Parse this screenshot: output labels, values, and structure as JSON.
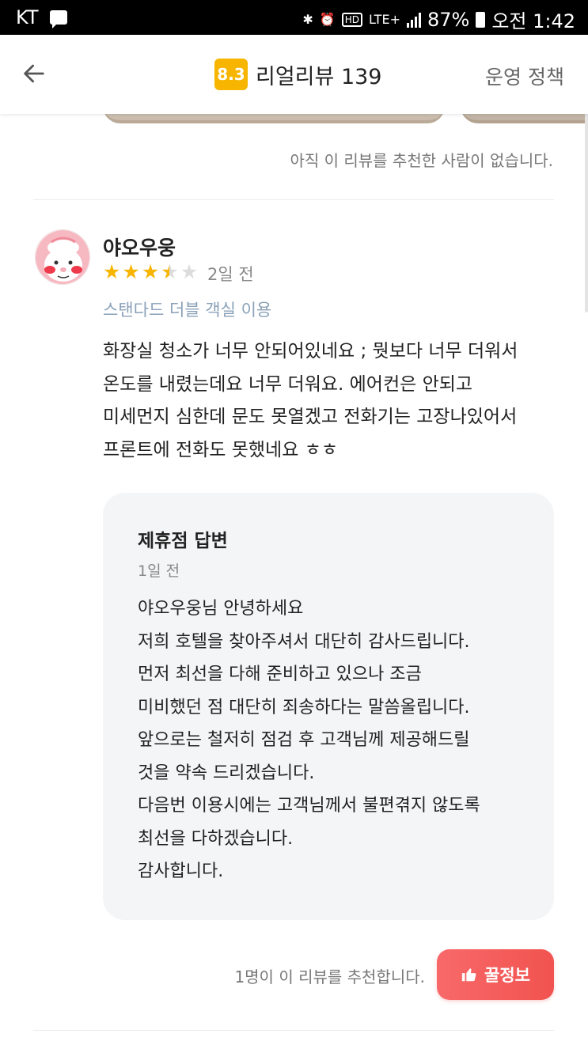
{
  "status_bar": {
    "carrier": "KT",
    "network": "LTE+",
    "hd": "HD",
    "battery": "87%",
    "time": "오전 1:42"
  },
  "header": {
    "score": "8.3",
    "title": "리얼리뷰 139",
    "policy_link": "운영 정책"
  },
  "previous_review": {
    "recommend_text": "아직 이 리뷰를 추천한 사람이 없습니다."
  },
  "review": {
    "reviewer": "야오우웅",
    "rating": 3.5,
    "date": "2일 전",
    "room_type": "스탠다드 더블 객실 이용",
    "body_lines": [
      "화장실 청소가 너무 안되어있네요 ; 뭣보다 너무 더워서",
      "온도를 내렸는데요 너무 더워요. 에어컨은 안되고",
      "미세먼지 심한데 문도 못열겠고 전화기는 고장나있어서",
      "프론트에 전화도 못했네요 ㅎㅎ"
    ],
    "reply": {
      "title": "제휴점 답변",
      "date": "1일 전",
      "body_lines": [
        "야오우웅님 안녕하세요",
        "저희 호텔을 찾아주셔서 대단히 감사드립니다.",
        "먼저 최선을 다해 준비하고 있으나 조금",
        "미비했던 점 대단히 죄송하다는 말씀올립니다.",
        "앞으로는 철저히 점검 후 고객님께 제공해드릴",
        "것을 약속 드리겠습니다.",
        "다음번 이용시에는 고객님께서 불편겪지 않도록",
        "최선을 다하겠습니다.",
        "감사합니다."
      ]
    },
    "recommend_text": "1명이 이 리뷰를 추천합니다.",
    "tip_button_label": "꿀정보"
  },
  "colors": {
    "badge": "#f7b500",
    "star": "#f7b500",
    "room_type": "#8aa1b8",
    "tip_button": "#f45c5b",
    "reply_bg": "#f4f5f7"
  },
  "icons": {
    "back": "arrow-left-icon",
    "thumb": "thumbs-up-icon",
    "message": "message-icon",
    "bluetooth": "bluetooth-icon",
    "alarm": "alarm-icon",
    "battery": "battery-icon"
  }
}
